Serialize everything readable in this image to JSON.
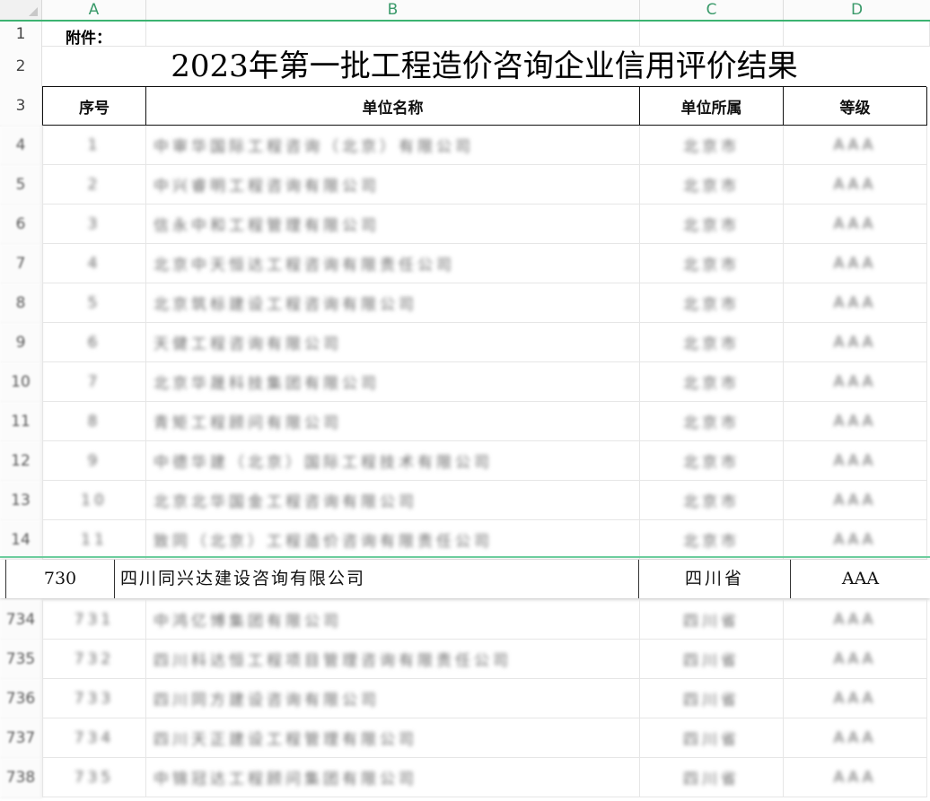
{
  "columns": [
    "A",
    "B",
    "C",
    "D"
  ],
  "sheet": {
    "attachment_label": "附件：",
    "title": "2023年第一批工程造价咨询企业信用评价结果",
    "headers": [
      "序号",
      "单位名称",
      "单位所属",
      "等级"
    ]
  },
  "top_rows": [
    {
      "row": "4",
      "seq": "1",
      "name": "中审华国际工程咨询（北京）有限公司",
      "region": "北京市",
      "grade": "AAA"
    },
    {
      "row": "5",
      "seq": "2",
      "name": "中兴睿明工程咨询有限公司",
      "region": "北京市",
      "grade": "AAA"
    },
    {
      "row": "6",
      "seq": "3",
      "name": "信永中和工程管理有限公司",
      "region": "北京市",
      "grade": "AAA"
    },
    {
      "row": "7",
      "seq": "4",
      "name": "北京中天恒达工程咨询有限责任公司",
      "region": "北京市",
      "grade": "AAA"
    },
    {
      "row": "8",
      "seq": "5",
      "name": "北京筑标建设工程咨询有限公司",
      "region": "北京市",
      "grade": "AAA"
    },
    {
      "row": "9",
      "seq": "6",
      "name": "天健工程咨询有限公司",
      "region": "北京市",
      "grade": "AAA"
    },
    {
      "row": "10",
      "seq": "7",
      "name": "北京华晟科技集团有限公司",
      "region": "北京市",
      "grade": "AAA"
    },
    {
      "row": "11",
      "seq": "8",
      "name": "青矩工程顾问有限公司",
      "region": "北京市",
      "grade": "AAA"
    },
    {
      "row": "12",
      "seq": "9",
      "name": "中德华建（北京）国际工程技术有限公司",
      "region": "北京市",
      "grade": "AAA"
    },
    {
      "row": "13",
      "seq": "10",
      "name": "北京北华国金工程咨询有限公司",
      "region": "北京市",
      "grade": "AAA"
    },
    {
      "row": "14",
      "seq": "11",
      "name": "致同（北京）工程造价咨询有限责任公司",
      "region": "北京市",
      "grade": "AAA"
    }
  ],
  "highlight_row": {
    "seq": "730",
    "name": "四川同兴达建设咨询有限公司",
    "region": "四川省",
    "grade": "AAA"
  },
  "bottom_rows": [
    {
      "row": "734",
      "seq": "731",
      "name": "中鸿亿博集团有限公司",
      "region": "四川省",
      "grade": "AAA"
    },
    {
      "row": "735",
      "seq": "732",
      "name": "四川科达恒工程项目管理咨询有限责任公司",
      "region": "四川省",
      "grade": "AAA"
    },
    {
      "row": "736",
      "seq": "733",
      "name": "四川同方建设咨询有限公司",
      "region": "四川省",
      "grade": "AAA"
    },
    {
      "row": "737",
      "seq": "734",
      "name": "四川天正建设工程管理有限公司",
      "region": "四川省",
      "grade": "AAA"
    },
    {
      "row": "738",
      "seq": "735",
      "name": "中锦冠达工程顾问集团有限公司",
      "region": "四川省",
      "grade": "AAA"
    }
  ],
  "top_row_numbers": [
    "1",
    "2",
    "3"
  ]
}
